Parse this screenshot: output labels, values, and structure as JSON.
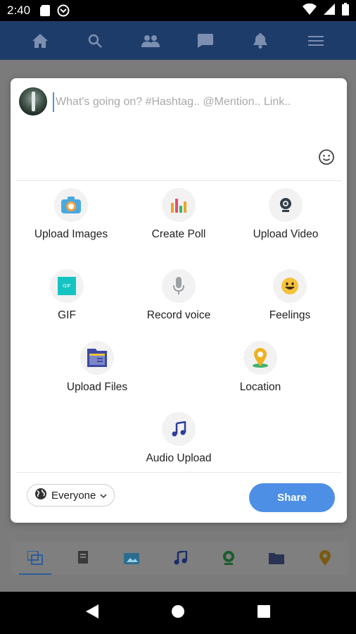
{
  "status_bar": {
    "time": "2:40"
  },
  "composer": {
    "placeholder": "What's going on? #Hashtag.. @Mention.. Link..",
    "options": [
      {
        "label": "Upload Images"
      },
      {
        "label": "Create Poll"
      },
      {
        "label": "Upload Video"
      },
      {
        "label": "GIF",
        "icon_text": "GIF"
      },
      {
        "label": "Record voice"
      },
      {
        "label": "Feelings"
      },
      {
        "label": "Upload Files"
      },
      {
        "label": "Location"
      },
      {
        "label": "Audio Upload"
      }
    ],
    "privacy_label": "Everyone",
    "share_label": "Share"
  },
  "colors": {
    "app_bar": "#1e3c6a",
    "share": "#4d8fe5",
    "accent_blue": "#2d5e9c"
  }
}
